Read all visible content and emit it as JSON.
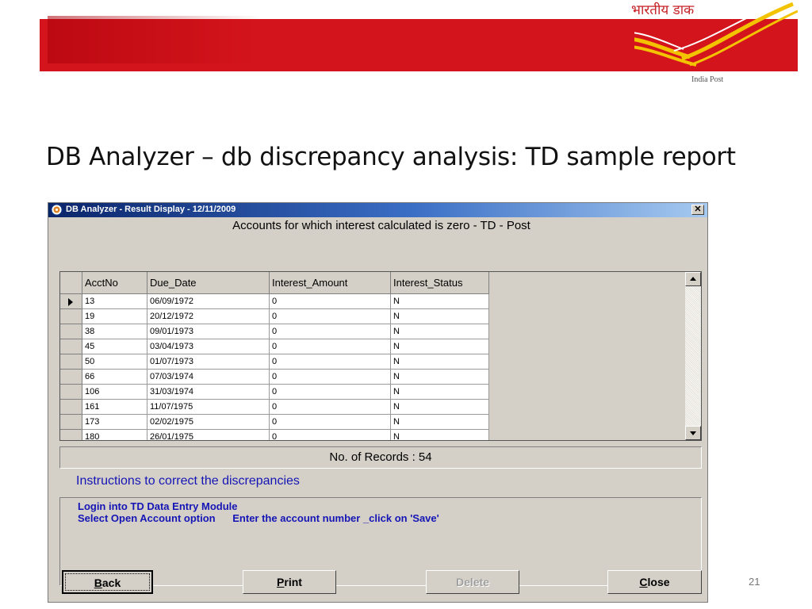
{
  "slide": {
    "logo_hindi": "भारतीय डाक",
    "logo_text": "India Post",
    "title": "DB Analyzer – db discrepancy analysis: TD sample report",
    "page_number": "21"
  },
  "window": {
    "title": "DB Analyzer - Result Display - 12/11/2009",
    "close_glyph": "✕",
    "heading": "Accounts for which interest calculated is zero - TD - Post"
  },
  "grid": {
    "columns": [
      "AcctNo",
      "Due_Date",
      "Interest_Amount",
      "Interest_Status"
    ],
    "rows": [
      [
        "13",
        "06/09/1972",
        "0",
        "N"
      ],
      [
        "19",
        "20/12/1972",
        "0",
        "N"
      ],
      [
        "38",
        "09/01/1973",
        "0",
        "N"
      ],
      [
        "45",
        "03/04/1973",
        "0",
        "N"
      ],
      [
        "50",
        "01/07/1973",
        "0",
        "N"
      ],
      [
        "66",
        "07/03/1974",
        "0",
        "N"
      ],
      [
        "106",
        "31/03/1974",
        "0",
        "N"
      ],
      [
        "161",
        "11/07/1975",
        "0",
        "N"
      ],
      [
        "173",
        "02/02/1975",
        "0",
        "N"
      ],
      [
        "180",
        "26/01/1975",
        "0",
        "N"
      ]
    ],
    "current_row": 0
  },
  "records_label": "No. of Records : 54",
  "instructions": {
    "title": "Instructions to correct the discrepancies",
    "lines": [
      "Login into TD Data Entry Module",
      "Select Open Account option      Enter the account number _click on 'Save'"
    ]
  },
  "buttons": {
    "back": "Back",
    "print": "Print",
    "delete": "Delete",
    "close": "Close"
  },
  "colors": {
    "banner": "#d4141c",
    "window_face": "#d4d0c8",
    "titlebar": "#0a246a",
    "instruction_text": "#1515b5"
  }
}
